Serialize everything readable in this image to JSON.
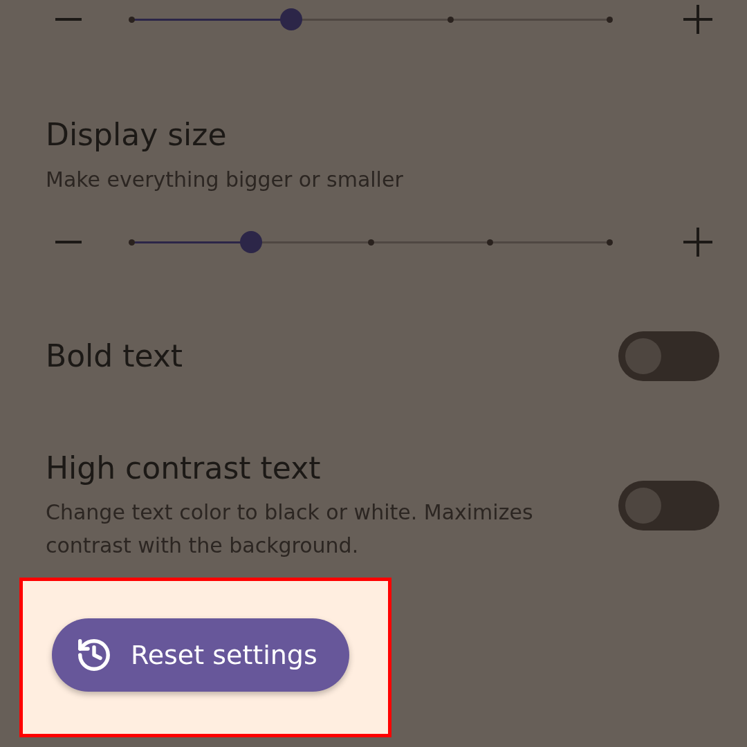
{
  "top_slider": {
    "kind": "four-step",
    "level": 0.3333
  },
  "display_size": {
    "title": "Display size",
    "subtitle": "Make everything bigger or smaller",
    "slider": {
      "kind": "five-step",
      "level": 0.25
    }
  },
  "toggles": [
    {
      "title": "Bold text",
      "on": false
    },
    {
      "title": "High contrast text",
      "description": "Change text color to black or white. Maximizes contrast with the background.",
      "on": false
    }
  ],
  "reset_button": {
    "label": "Reset settings",
    "highlighted": true
  }
}
